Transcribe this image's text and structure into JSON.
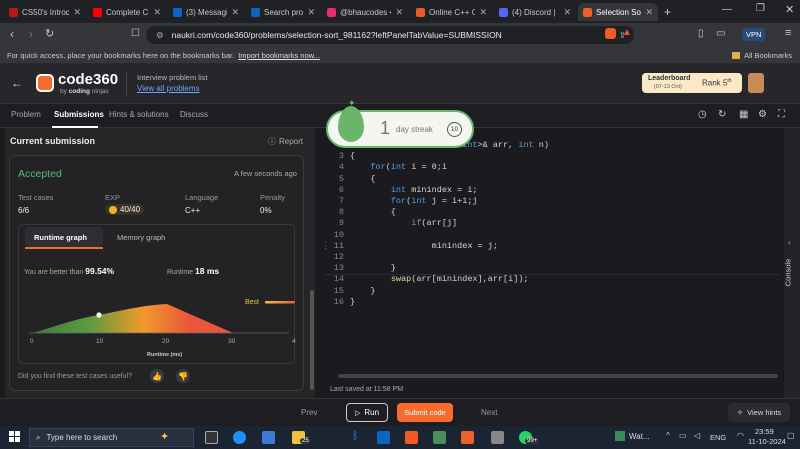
{
  "tabs": [
    {
      "label": "CS50's Introductio",
      "color": "#b31b1b"
    },
    {
      "label": "Complete C++ Pl",
      "color": "#ff0000"
    },
    {
      "label": "(3) Messaging | L",
      "color": "#0a66c2"
    },
    {
      "label": "Search professio",
      "color": "#0a66c2"
    },
    {
      "label": "@bhaucodes • In",
      "color": "#e1306c"
    },
    {
      "label": "Online C++ Com",
      "color": "#e25b2b"
    },
    {
      "label": "(4) Discord | ",
      "color": "#5865f2"
    },
    {
      "label": "Selection So",
      "color": "#e8622a"
    }
  ],
  "browser": {
    "url": "naukri.com/code360/problems/selection-sort_981162?leftPanelTabValue=SUBMISSION",
    "vpn": "VPN",
    "bookmarks_hint": "For quick access, place your bookmarks here on the bookmarks bar.",
    "bookmarks_link": "Import bookmarks now...",
    "all_bookmarks": "All Bookmarks"
  },
  "header": {
    "logo_code": "code",
    "logo_num": "360",
    "logo_sub_by": "by",
    "logo_sub_brand": "coding",
    "logo_sub_brand2": "ninjas",
    "list_title": "Interview problem list",
    "view_all": "View all problems",
    "leaderboard_title": "Leaderboard",
    "leaderboard_dates": "(07-13 Oct)",
    "rank": "Rank 5",
    "rank_sup": "th"
  },
  "subtabs": [
    "Problem",
    "Submissions",
    "Hints & solutions",
    "Discuss"
  ],
  "streak": {
    "number": "1",
    "label": "day streak",
    "count": "10"
  },
  "submission": {
    "title": "Current submission",
    "report": "Report",
    "status": "Accepted",
    "time": "A few seconds ago",
    "stats_labels": [
      "Test cases",
      "EXP",
      "Language",
      "Penalty"
    ],
    "stats_values": [
      "6/6",
      "40/40",
      "C++",
      "0%"
    ],
    "graph_tabs": [
      "Runtime graph",
      "Memory graph"
    ],
    "better_label": "You are better than",
    "better_value": "99.54%",
    "runtime_label": "Runtime",
    "runtime_value": "18 ms",
    "best": "Best",
    "x_ticks": [
      "0",
      "10",
      "20",
      "30",
      "40"
    ],
    "x_label": "Runtime (ms)",
    "feedback": "Did you find these test cases useful?"
  },
  "code": {
    "lines": [
      {
        "n": "",
        "text": "                  tor<int>& arr, int n)"
      },
      {
        "n": "3",
        "text": "{"
      },
      {
        "n": "4",
        "text": "    for(int i = 0;i<n-1;i++)"
      },
      {
        "n": "5",
        "text": "    {"
      },
      {
        "n": "6",
        "text": "        int minindex = i;"
      },
      {
        "n": "7",
        "text": "        for(int j = i+1;j<n;j++)"
      },
      {
        "n": "8",
        "text": "        {"
      },
      {
        "n": "9",
        "text": "            if(arr[j]<arr[minindex])"
      },
      {
        "n": "10",
        "text": ""
      },
      {
        "n": "11",
        "text": "                minindex = j;"
      },
      {
        "n": "12",
        "text": ""
      },
      {
        "n": "13",
        "text": "        }"
      },
      {
        "n": "14",
        "text": "        swap(arr[minindex],arr[i]);"
      },
      {
        "n": "15",
        "text": "    }"
      },
      {
        "n": "16",
        "text": "}"
      }
    ],
    "saved": "Last saved at 11:58 PM",
    "console": "Console"
  },
  "bottom": {
    "prev": "Prev",
    "run": "Run",
    "submit": "Submit code",
    "next": "Next",
    "hints": "View hints"
  },
  "taskbar": {
    "search": "Type here to search",
    "weather": "Wat...",
    "lang": "ENG",
    "time": "23:59",
    "date": "11-10-2024",
    "badge1": "25",
    "badge2": "99+"
  },
  "colors": {
    "accent": "#f76b2d",
    "accepted": "#5fb878",
    "streak": "#6ab56a"
  }
}
